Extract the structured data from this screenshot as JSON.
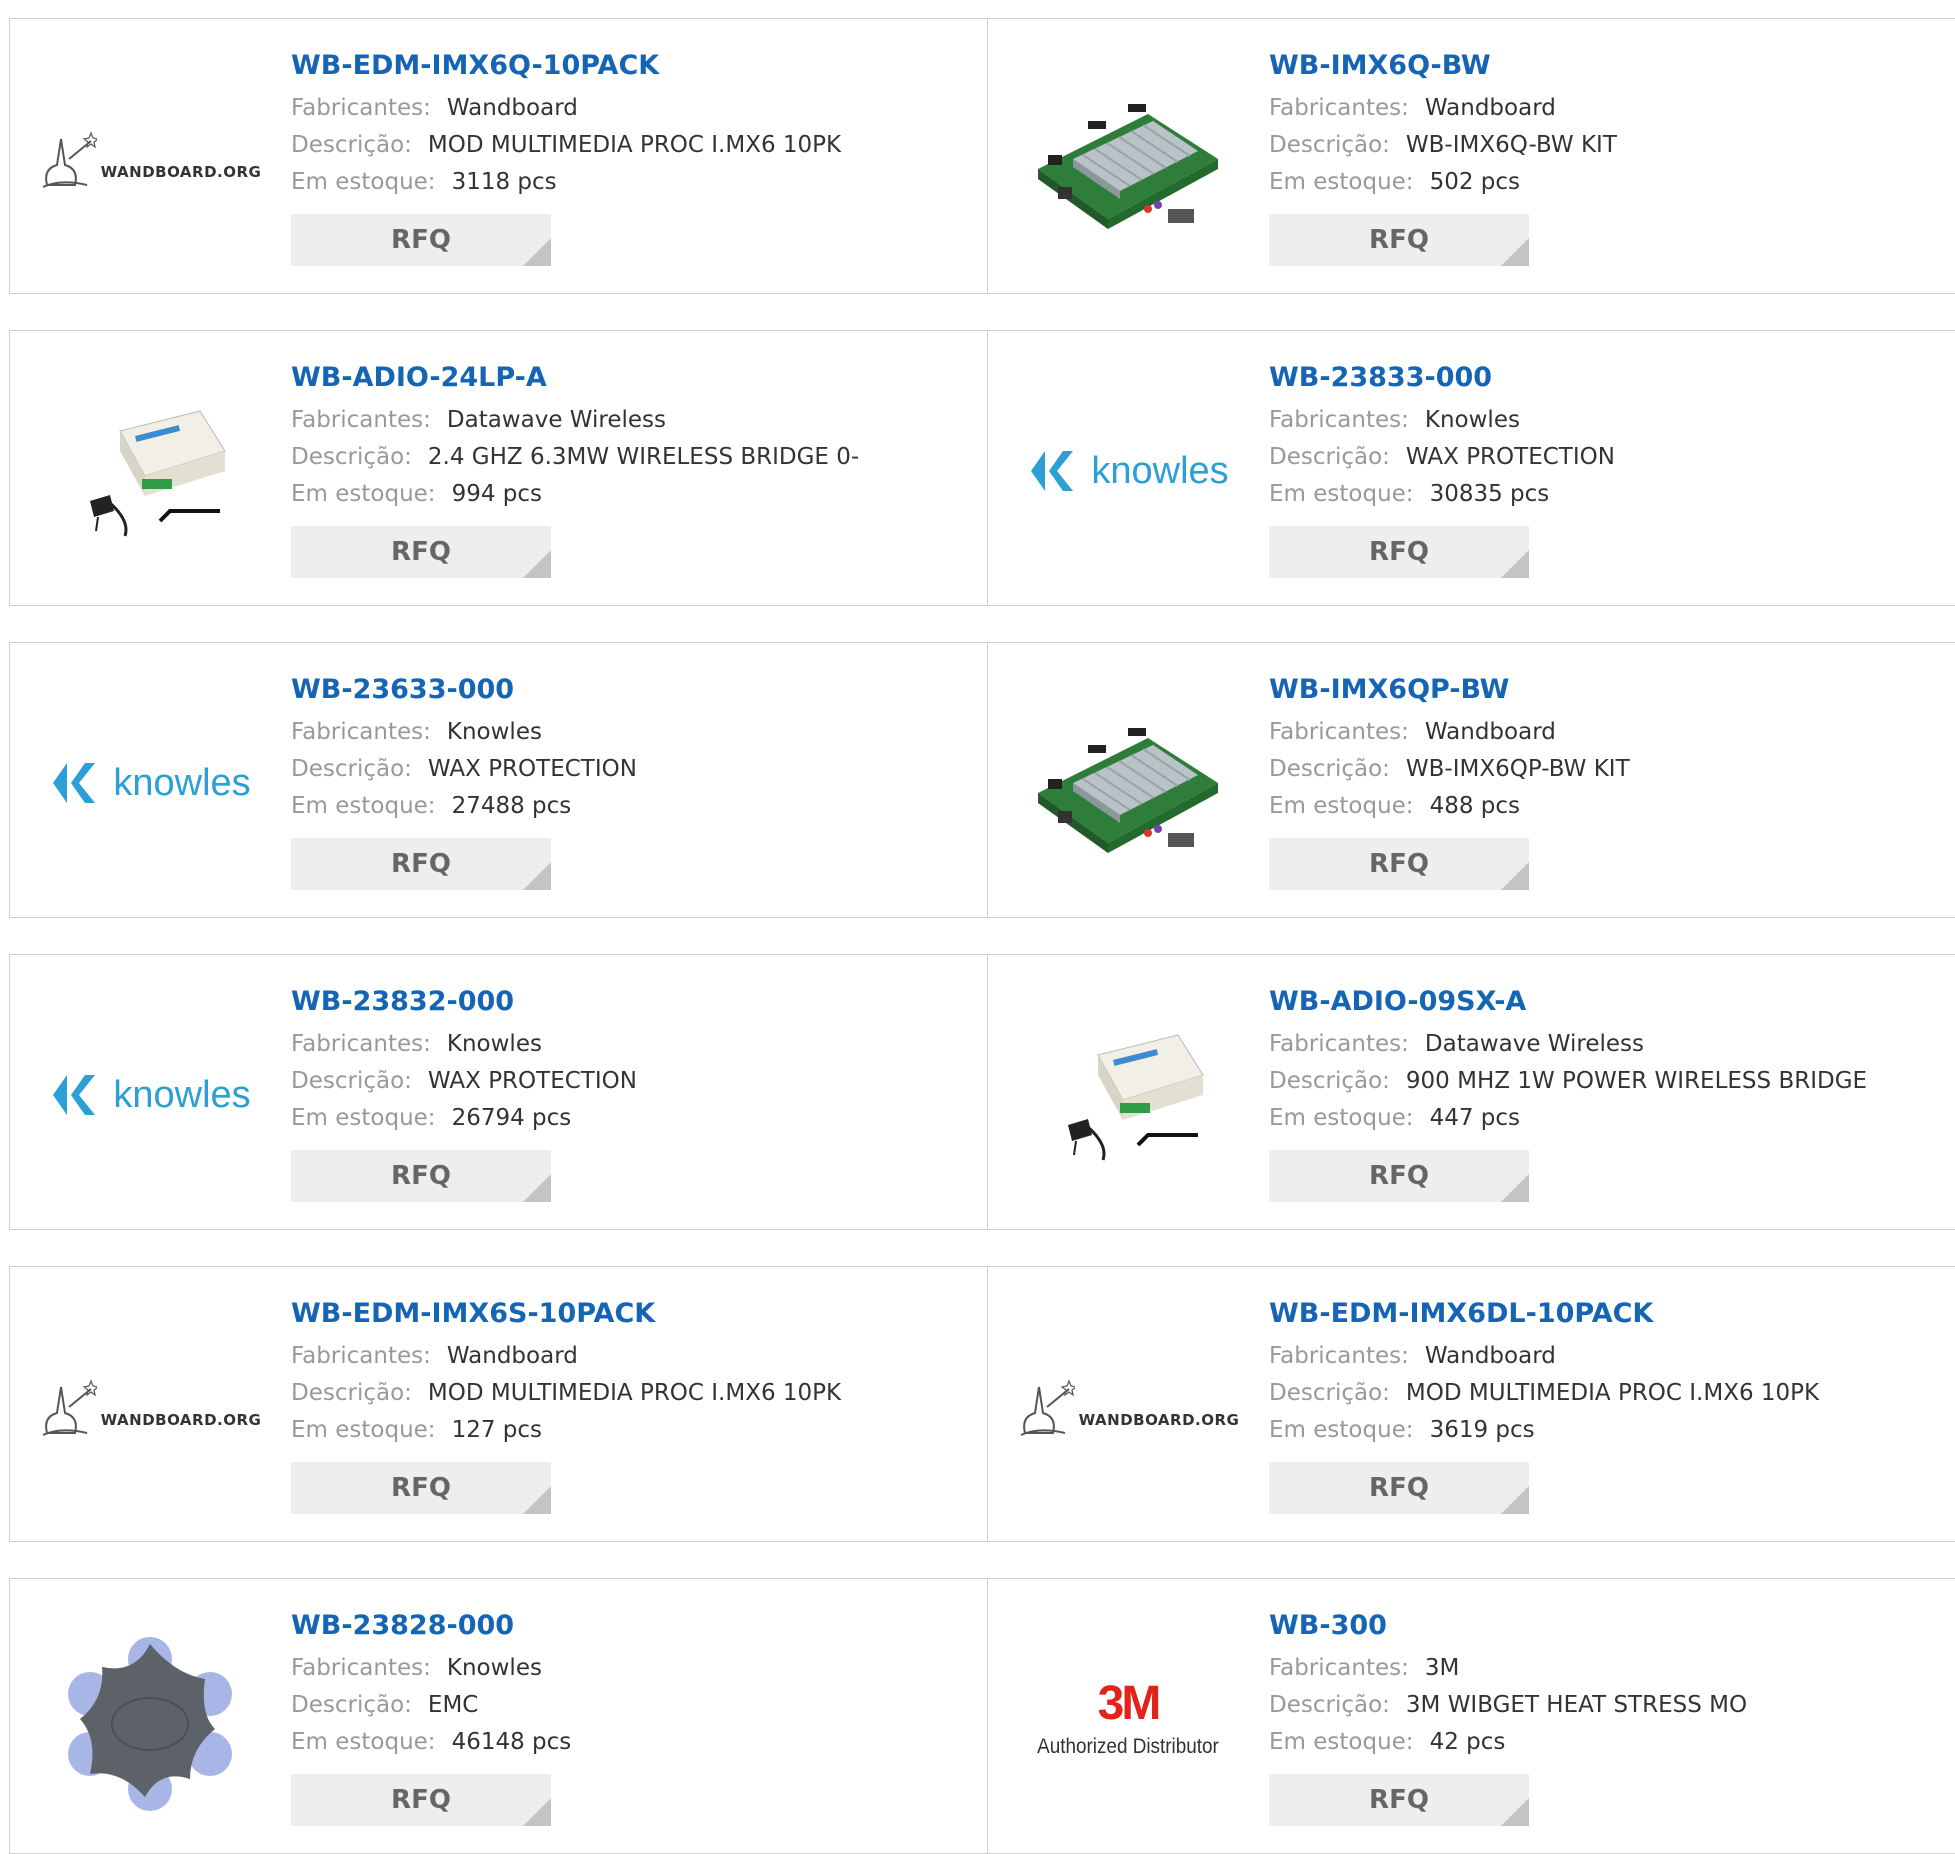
{
  "labels": {
    "manufacturer": "Fabricantes:",
    "description": "Descrição:",
    "stock": "Em estoque:",
    "rfq": "RFQ"
  },
  "products": [
    {
      "part": "WB-EDM-IMX6Q-10PACK",
      "manufacturer": "Wandboard",
      "description": "MOD MULTIMEDIA PROC I.MX6 10PK",
      "stock": "3118 pcs",
      "image": "wandboard-logo",
      "logo_text": "WANDBOARD.ORG"
    },
    {
      "part": "WB-IMX6Q-BW",
      "manufacturer": "Wandboard",
      "description": "WB-IMX6Q-BW KIT",
      "stock": "502 pcs",
      "image": "circuit-board-photo"
    },
    {
      "part": "WB-ADIO-24LP-A",
      "manufacturer": "Datawave Wireless",
      "description": "2.4 GHZ 6.3MW WIRELESS BRIDGE 0-",
      "stock": "994 pcs",
      "image": "wireless-bridge-photo"
    },
    {
      "part": "WB-23833-000",
      "manufacturer": "Knowles",
      "description": "WAX PROTECTION",
      "stock": "30835 pcs",
      "image": "knowles-logo",
      "logo_text": "knowles"
    },
    {
      "part": "WB-23633-000",
      "manufacturer": "Knowles",
      "description": "WAX PROTECTION",
      "stock": "27488 pcs",
      "image": "knowles-logo",
      "logo_text": "knowles"
    },
    {
      "part": "WB-IMX6QP-BW",
      "manufacturer": "Wandboard",
      "description": "WB-IMX6QP-BW KIT",
      "stock": "488 pcs",
      "image": "circuit-board-photo"
    },
    {
      "part": "WB-23832-000",
      "manufacturer": "Knowles",
      "description": "WAX PROTECTION",
      "stock": "26794 pcs",
      "image": "knowles-logo",
      "logo_text": "knowles"
    },
    {
      "part": "WB-ADIO-09SX-A",
      "manufacturer": "Datawave Wireless",
      "description": "900 MHZ 1W POWER WIRELESS BRIDGE",
      "stock": "447 pcs",
      "image": "wireless-bridge-photo"
    },
    {
      "part": "WB-EDM-IMX6S-10PACK",
      "manufacturer": "Wandboard",
      "description": "MOD MULTIMEDIA PROC I.MX6 10PK",
      "stock": "127 pcs",
      "image": "wandboard-logo",
      "logo_text": "WANDBOARD.ORG"
    },
    {
      "part": "WB-EDM-IMX6DL-10PACK",
      "manufacturer": "Wandboard",
      "description": "MOD MULTIMEDIA PROC I.MX6 10PK",
      "stock": "3619 pcs",
      "image": "wandboard-logo",
      "logo_text": "WANDBOARD.ORG"
    },
    {
      "part": "WB-23828-000",
      "manufacturer": "Knowles",
      "description": "EMC",
      "stock": "46148 pcs",
      "image": "ear-tip-photo"
    },
    {
      "part": "WB-300",
      "manufacturer": "3M",
      "description": "3M WIBGET HEAT STRESS MO",
      "stock": "42 pcs",
      "image": "3m-logo",
      "logo_text": "3M",
      "logo_subtext": "Authorized Distributor"
    }
  ]
}
